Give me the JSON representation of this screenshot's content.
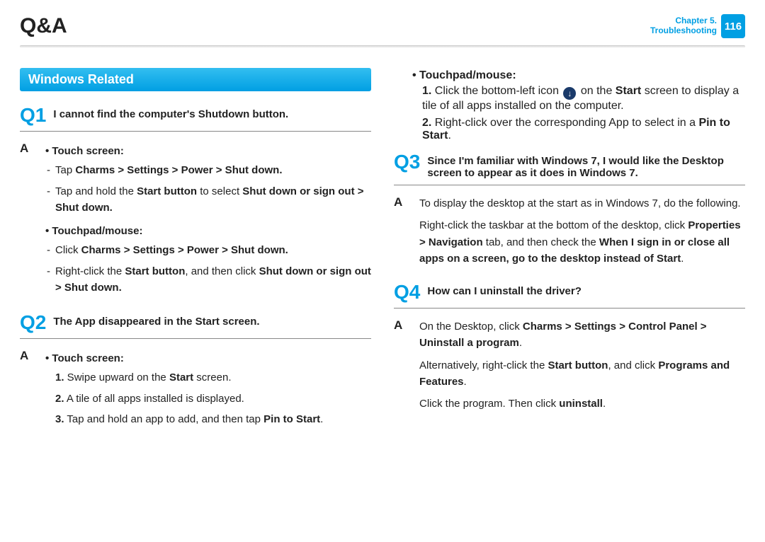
{
  "header": {
    "title": "Q&A",
    "chapter_line1": "Chapter 5.",
    "chapter_line2": "Troubleshooting",
    "page_number": "116"
  },
  "section_title": "Windows Related",
  "left": {
    "q1": {
      "label": "Q1",
      "text": "I cannot find the computer's Shutdown button."
    },
    "a1": {
      "label": "A",
      "touch_head": "• Touch screen:",
      "touch_item1_prefix": "Tap ",
      "touch_item1_bold": "Charms > Settings > Power > Shut down.",
      "touch_item2_prefix": "Tap and hold the ",
      "touch_item2_b1": "Start button",
      "touch_item2_mid": " to select ",
      "touch_item2_b2": "Shut down or sign out > Shut down.",
      "mouse_head": "• Touchpad/mouse:",
      "mouse_item1_prefix": "Click ",
      "mouse_item1_bold": "Charms > Settings > Power > Shut down.",
      "mouse_item2_prefix": "Right-click the ",
      "mouse_item2_b1": "Start button",
      "mouse_item2_mid": ", and then click ",
      "mouse_item2_b2": "Shut down or sign out > Shut down."
    },
    "q2": {
      "label": "Q2",
      "text": "The App disappeared in the Start screen."
    },
    "a2": {
      "label": "A",
      "touch_head": "• Touch screen:",
      "n1_num": "1.",
      "n1_pre": " Swipe upward on the ",
      "n1_b": "Start",
      "n1_post": " screen.",
      "n2_num": "2.",
      "n2_text": " A tile of all apps installed is displayed.",
      "n3_num": "3.",
      "n3_pre": " Tap and hold an app to add, and then tap ",
      "n3_b": "Pin to Start",
      "n3_post": "."
    }
  },
  "right": {
    "mouse_head": "• Touchpad/mouse:",
    "r1_num": "1.",
    "r1_pre": " Click the bottom-left icon ",
    "r1_mid": " on the ",
    "r1_b": "Start",
    "r1_post": " screen to display a tile of all apps installed on the computer.",
    "r2_num": "2.",
    "r2_pre": " Right-click over the corresponding App to select in a ",
    "r2_b": "Pin to Start",
    "r2_post": ".",
    "q3": {
      "label": "Q3",
      "text": "Since I'm familiar with Windows 7, I would like the Desktop screen to appear as it does in Windows 7."
    },
    "a3": {
      "label": "A",
      "p1": "To display the desktop at the start as in Windows 7, do the following.",
      "p2_pre": "Right-click the taskbar at the bottom of the desktop, click ",
      "p2_b1": "Properties > Navigation",
      "p2_mid": " tab, and then check the ",
      "p2_b2": "When I sign in or close all apps on a screen, go to the desktop instead of Start",
      "p2_post": "."
    },
    "q4": {
      "label": "Q4",
      "text": "How can I uninstall the driver?"
    },
    "a4": {
      "label": "A",
      "p1_pre": "On the Desktop, click ",
      "p1_b1": "Charms > Settings > Control Panel > Uninstall a program",
      "p1_post": ".",
      "p2_pre": "Alternatively, right-click the ",
      "p2_b1": "Start button",
      "p2_mid": ", and click ",
      "p2_b2": "Programs and Features",
      "p2_post": ".",
      "p3_pre": "Click the program. Then click ",
      "p3_b": "uninstall",
      "p3_post": "."
    }
  },
  "icons": {
    "down_arrow": "↓"
  }
}
